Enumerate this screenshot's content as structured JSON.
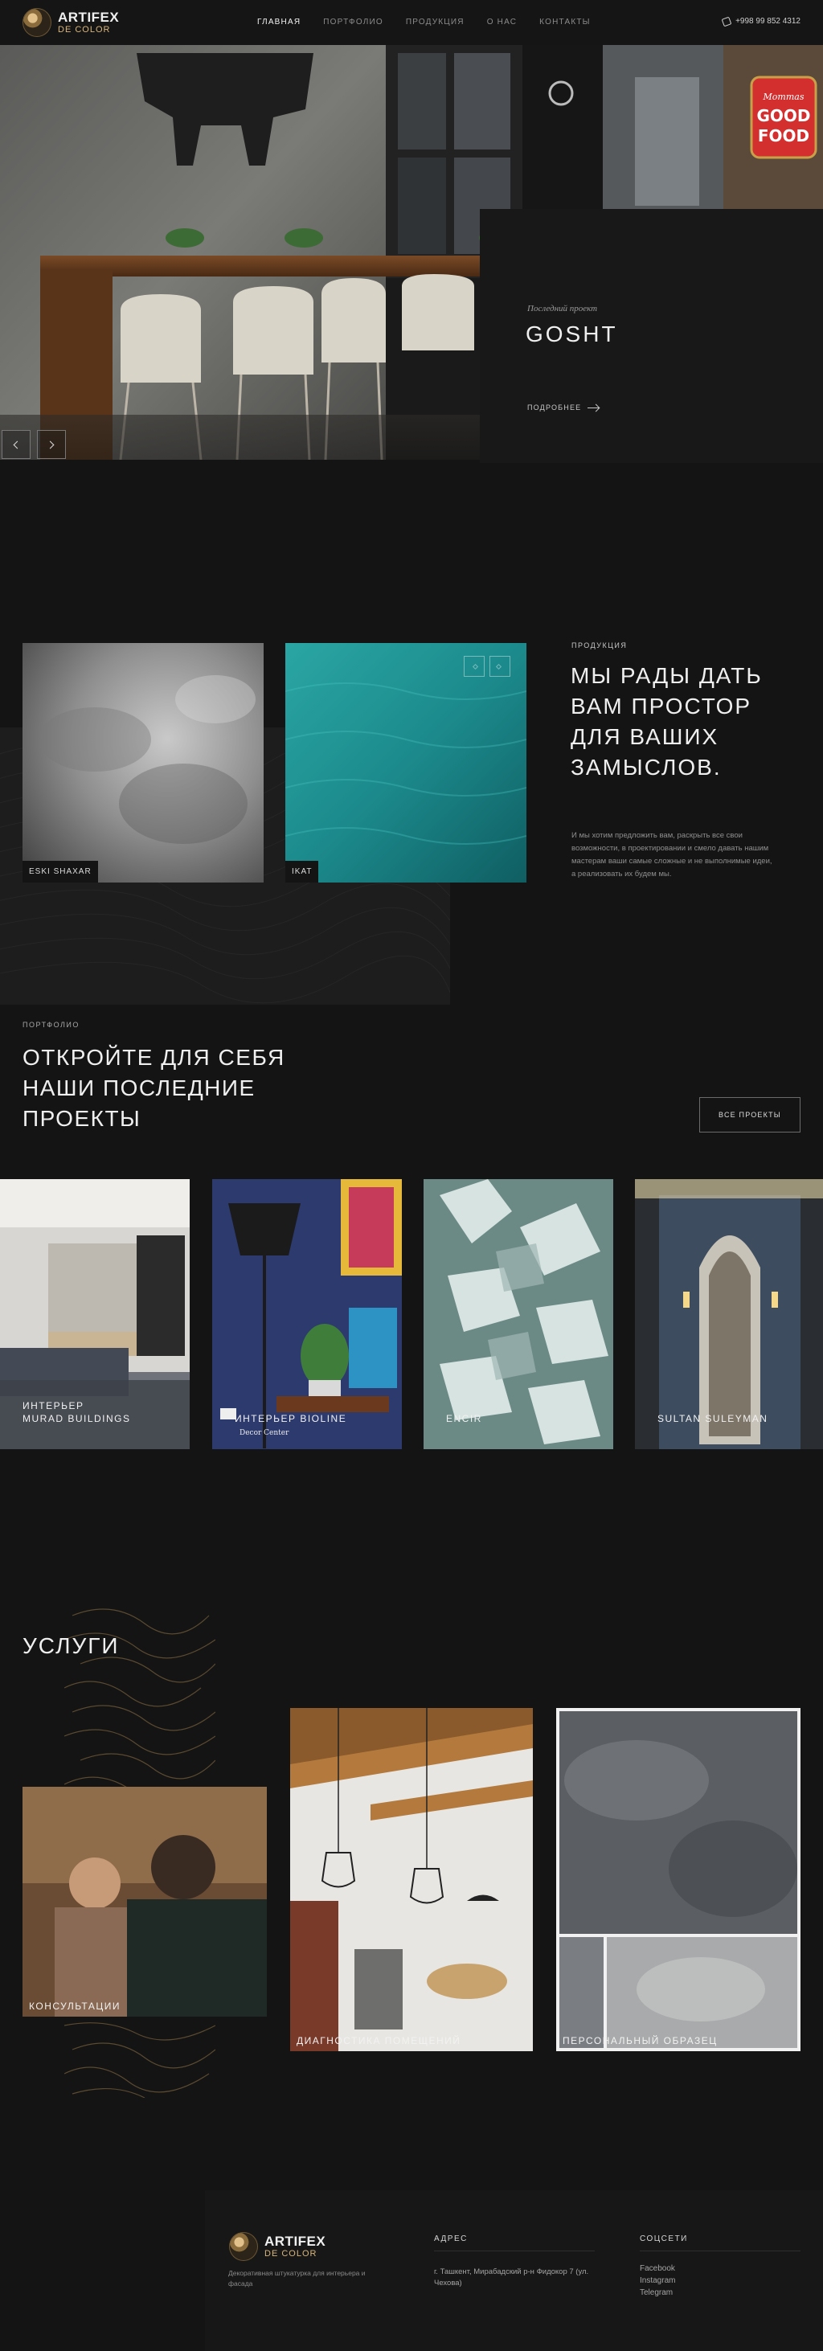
{
  "header": {
    "logo": {
      "line1": "ARTIFEX",
      "line2": "DE COLOR"
    },
    "nav": [
      {
        "label": "ГЛАВНАЯ",
        "active": true
      },
      {
        "label": "ПОРТФОЛИО",
        "active": false
      },
      {
        "label": "ПРОДУКЦИЯ",
        "active": false
      },
      {
        "label": "О НАС",
        "active": false
      },
      {
        "label": "КОНТАКТЫ",
        "active": false
      }
    ],
    "phone": "+998 99 852 4312"
  },
  "hero": {
    "kicker": "Последний проект",
    "title": "GOSHT",
    "more": "ПОДРОБНЕЕ",
    "sign_text": [
      "Mommas",
      "GOOD",
      "FOOD"
    ]
  },
  "products": {
    "kicker": "ПРОДУКЦИЯ",
    "title": "МЫ РАДЫ ДАТЬ ВАМ ПРОСТОР ДЛЯ ВАШИХ ЗАМЫСЛОВ.",
    "text": "И мы хотим предложить вам, раскрыть все свои возможности, в проектировании и смело давать нашим мастерам ваши самые сложные и не выполнимые идеи, а реализовать их будем мы.",
    "cards": [
      {
        "label": "ESKI SHAXAR"
      },
      {
        "label": "IKAT"
      }
    ]
  },
  "portfolio": {
    "kicker": "ПОРТФОЛИО",
    "title": "ОТКРОЙТЕ ДЛЯ СЕБЯ НАШИ ПОСЛЕДНИЕ ПРОЕКТЫ",
    "all_button": "ВСЕ ПРОЕКТЫ",
    "items": [
      {
        "line1": "ИНТЕРЬЕР",
        "line2": "MURAD BUILDINGS"
      },
      {
        "line1": "ИНТЕРЬЕР BIOLINE",
        "line2": ""
      },
      {
        "line1": "ENCIR",
        "line2": ""
      },
      {
        "line1": "SULTAN SULEYMAN",
        "line2": ""
      }
    ],
    "photo_caption": "Decor Center"
  },
  "services": {
    "title": "УСЛУГИ",
    "items": [
      {
        "label": "КОНСУЛЬТАЦИИ"
      },
      {
        "label": "ДИАГНОСТИКА ПОМЕЩЕНИЙ"
      },
      {
        "label": "ПЕРСОНАЛЬНЫЙ ОБРАЗЕЦ"
      }
    ]
  },
  "footer": {
    "logo": {
      "line1": "ARTIFEX",
      "line2": "DE COLOR"
    },
    "description": "Декоративная штукатурка для интерьера и фасада",
    "address_heading": "АДРЕС",
    "address": "г. Ташкент, Мирабадский р-н Фидокор 7 (ул. Чехова)",
    "social_heading": "СОЦСЕТИ",
    "social_links": [
      "Facebook",
      "Instagram",
      "Telegram"
    ]
  },
  "colors": {
    "background": "#141414",
    "panel": "#181818",
    "accent_gold": "#d7b57b",
    "text_primary": "#efefef",
    "text_muted": "#8f8f8f"
  },
  "icons": [
    "phone-icon",
    "chevron-left-icon",
    "chevron-right-icon",
    "arrow-right-icon",
    "logo-mark-icon"
  ]
}
